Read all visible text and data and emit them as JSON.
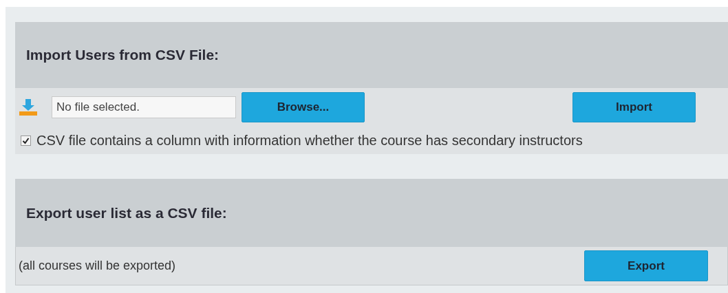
{
  "import_panel": {
    "title": "Import Users from CSV File:",
    "file_field": {
      "placeholder": "No file selected."
    },
    "browse_button": "Browse...",
    "import_button": "Import",
    "option": {
      "label": "CSV file contains a column with information whether the course has secondary instructors",
      "checked": true
    }
  },
  "export_panel": {
    "title": "Export user list as a CSV file:",
    "note": "(all courses will be exported)",
    "export_button": "Export"
  }
}
